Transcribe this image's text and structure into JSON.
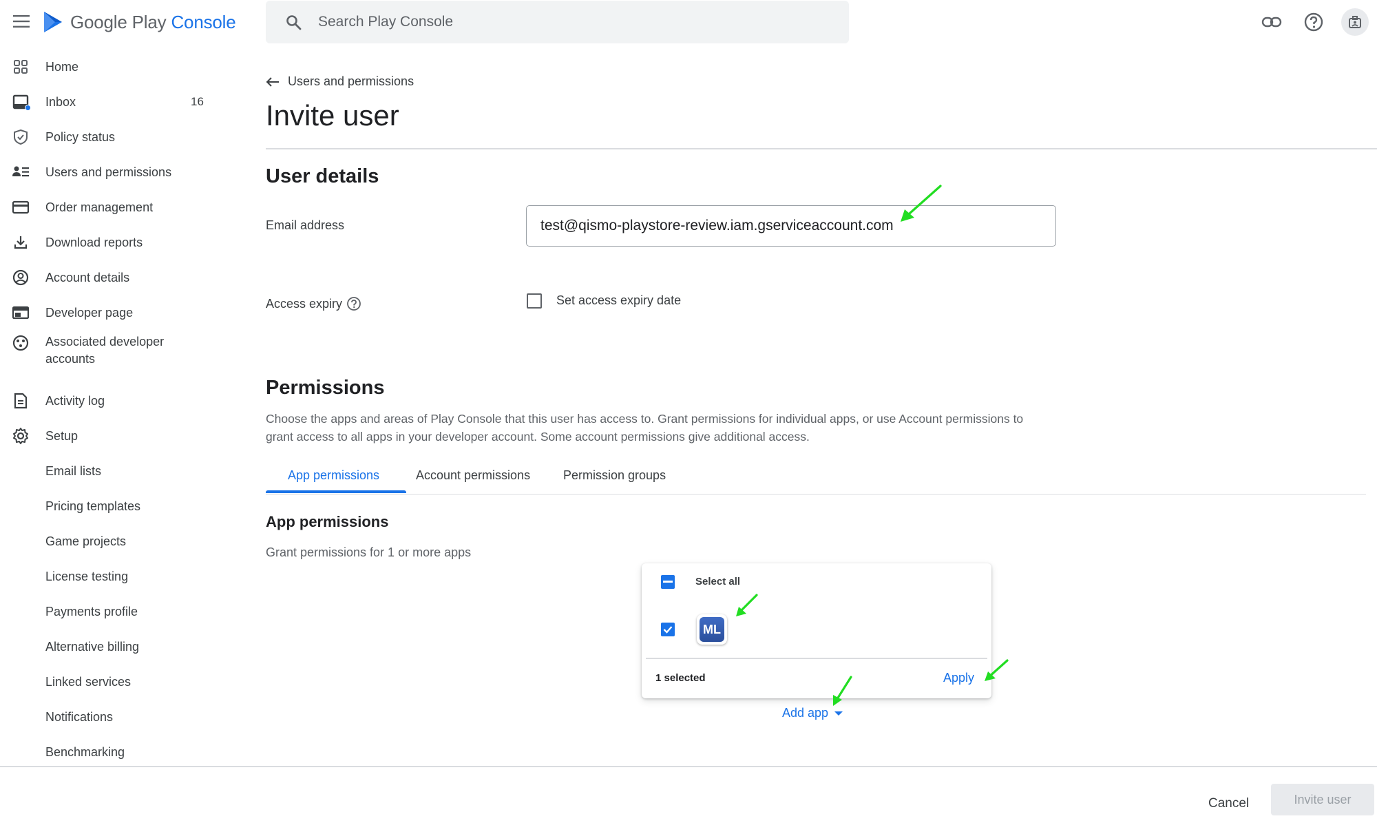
{
  "app": {
    "logo_text_primary": "Google Play",
    "logo_text_accent": "Console"
  },
  "search": {
    "placeholder": "Search Play Console"
  },
  "sidebar": {
    "items": [
      {
        "label": "Home",
        "icon": "grid-icon"
      },
      {
        "label": "Inbox",
        "icon": "inbox-icon",
        "count": "16"
      },
      {
        "label": "Policy status",
        "icon": "shield-icon"
      },
      {
        "label": "Users and permissions",
        "icon": "users-icon"
      },
      {
        "label": "Order management",
        "icon": "credit-card-icon"
      },
      {
        "label": "Download reports",
        "icon": "download-icon"
      },
      {
        "label": "Account details",
        "icon": "account-circle-icon"
      },
      {
        "label": "Developer page",
        "icon": "web-page-icon"
      },
      {
        "label": "Associated developer accounts",
        "icon": "linked-accounts-icon"
      },
      {
        "label": "Activity log",
        "icon": "document-icon"
      },
      {
        "label": "Setup",
        "icon": "gear-icon"
      },
      {
        "label": "Email lists"
      },
      {
        "label": "Pricing templates"
      },
      {
        "label": "Game projects"
      },
      {
        "label": "License testing"
      },
      {
        "label": "Payments profile"
      },
      {
        "label": "Alternative billing"
      },
      {
        "label": "Linked services"
      },
      {
        "label": "Notifications"
      },
      {
        "label": "Benchmarking"
      }
    ]
  },
  "main": {
    "breadcrumb": "Users and permissions",
    "title": "Invite user",
    "user_details": {
      "heading": "User details",
      "email_label": "Email address",
      "email_value": "test@qismo-playstore-review.iam.gserviceaccount.com",
      "access_expiry_label": "Access expiry",
      "access_expiry_checkbox": "Set access expiry date"
    },
    "permissions": {
      "heading": "Permissions",
      "description": "Choose the apps and areas of Play Console that this user has access to. Grant permissions for individual apps, or use Account permissions to grant access to all apps in your developer account. Some account permissions give additional access.",
      "tabs": [
        {
          "label": "App permissions",
          "active": true
        },
        {
          "label": "Account permissions",
          "active": false
        },
        {
          "label": "Permission groups",
          "active": false
        }
      ],
      "app_permissions_heading": "App permissions",
      "app_permissions_desc": "Grant permissions for 1 or more apps"
    },
    "popup": {
      "select_all_label": "Select all",
      "app_icon_text": "ML",
      "selected_count": "1 selected",
      "apply_label": "Apply"
    },
    "add_app_label": "Add app"
  },
  "footer": {
    "cancel_label": "Cancel",
    "invite_label": "Invite user"
  },
  "colors": {
    "accent": "#1a73e8",
    "annotation_arrow": "#22dd22"
  }
}
